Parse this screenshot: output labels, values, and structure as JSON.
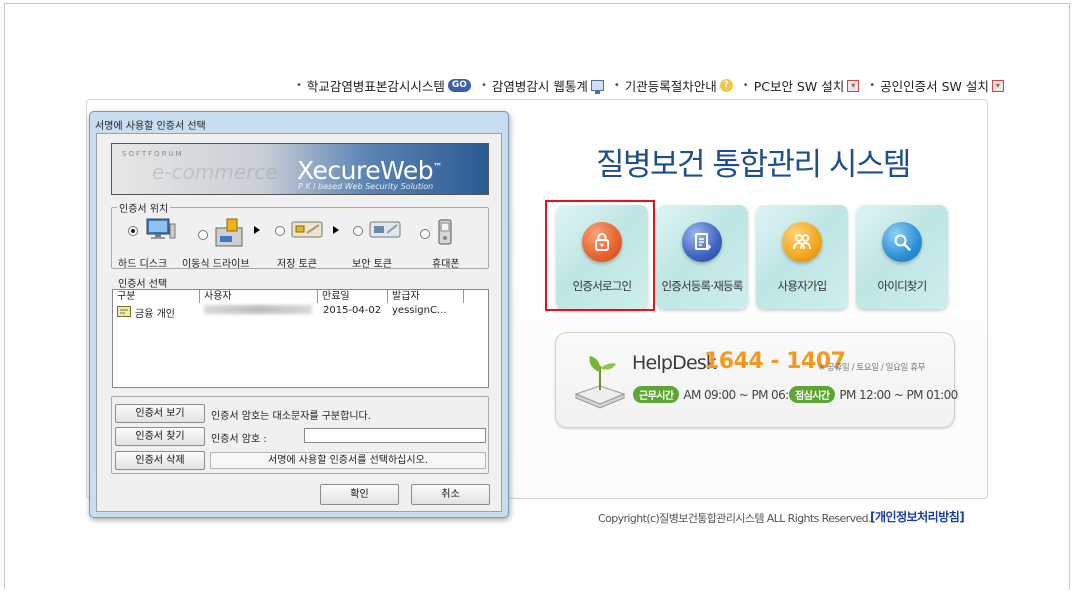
{
  "top_nav": [
    {
      "label": "학교감염병표본감시시스템",
      "icon": "go-icon",
      "icon_text": "GO"
    },
    {
      "label": "감염병감시 웹통계",
      "icon": "monitor-icon"
    },
    {
      "label": "기관등록절차안내",
      "icon": "help-icon",
      "icon_text": "?"
    },
    {
      "label": "PC보안 SW 설치",
      "icon": "download-icon"
    },
    {
      "label": "공인인증서 SW 설치",
      "icon": "download-icon"
    }
  ],
  "system_title": "질병보건 통합관리 시스템",
  "tiles": [
    {
      "label": "인증서로그인",
      "icon": "lock-icon",
      "color": "#e8622c"
    },
    {
      "label": "인증서등록·재등록",
      "icon": "document-icon",
      "color": "#3d63c2"
    },
    {
      "label": "사용자가입",
      "icon": "users-icon",
      "color": "#f3a51c"
    },
    {
      "label": "아이디찾기",
      "icon": "magnifier-icon",
      "color": "#2e8fd6"
    }
  ],
  "helpdesk": {
    "title": "HelpDesk",
    "phone": "1644 - 1407",
    "note": "※ 공휴일 / 토요일 / 일요일 휴무",
    "work_label": "근무시간",
    "work_hours": "AM 09:00 ~ PM 06:00",
    "lunch_label": "점심시간",
    "lunch_hours": "PM 12:00 ~ PM 01:00"
  },
  "footer": {
    "copyright": "Copyright(c)질병보건통합관리시스템 ALL Rights Reserved.",
    "privacy_link": "[개인정보처리방침]"
  },
  "dialog": {
    "title": "서명에 사용할 인증서 선택",
    "banner": {
      "brand_small": "SOFTFORUM",
      "logo": "XecureWeb",
      "tm": "™",
      "subtitle": "P K I based Web Security Solution"
    },
    "location_group_label": "인증서 위치",
    "locations": [
      {
        "label": "하드 디스크",
        "icon": "hard-disk-icon",
        "selected": true
      },
      {
        "label": "이동식 드라이브",
        "icon": "removable-drive-icon",
        "selected": false
      },
      {
        "label": "저장 토큰",
        "icon": "storage-token-icon",
        "selected": false
      },
      {
        "label": "보안 토큰",
        "icon": "security-token-icon",
        "selected": false
      },
      {
        "label": "휴대폰",
        "icon": "mobile-phone-icon",
        "selected": false
      }
    ],
    "cert_group_label": "인증서 선택",
    "columns": [
      "구분",
      "사용자",
      "만료일",
      "발급자"
    ],
    "rows": [
      {
        "type": "금융 개인",
        "user": "",
        "expiry": "2015-04-02",
        "issuer": "yessignC..."
      }
    ],
    "view_button": "인증서 보기",
    "view_text": "인증서 암호는 대소문자를 구분합니다.",
    "find_button": "인증서 찾기",
    "password_label": "인증서 암호 :",
    "delete_button": "인증서 삭제",
    "status": "서명에 사용할 인증서를 선택하십시오.",
    "ok_button": "확인",
    "cancel_button": "취소"
  }
}
